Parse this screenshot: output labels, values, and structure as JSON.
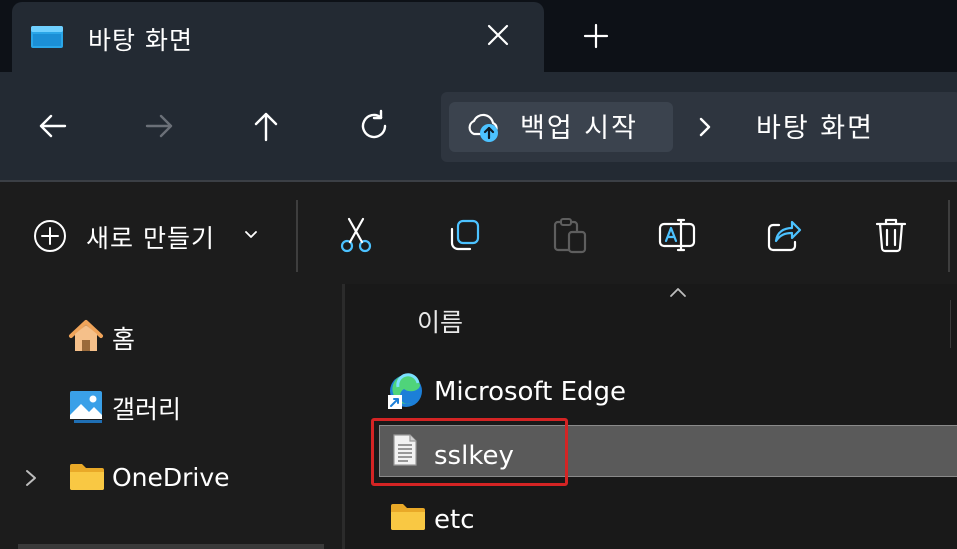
{
  "tab": {
    "title": "바탕 화면",
    "icon": "desktop-folder-icon",
    "close_icon": "close-icon",
    "new_tab_icon": "plus-icon"
  },
  "nav": {
    "back_icon": "arrow-left-icon",
    "forward_icon": "arrow-right-icon",
    "up_icon": "arrow-up-icon",
    "refresh_icon": "refresh-icon"
  },
  "address": {
    "backup_label": "백업 시작",
    "backup_icon": "cloud-upload-icon",
    "separator": "chevron-right-icon",
    "current": "바탕 화면"
  },
  "toolbar": {
    "new_label": "새로 만들기",
    "new_icon": "circle-plus-icon",
    "actions": [
      "cut-icon",
      "copy-icon",
      "paste-icon",
      "rename-icon",
      "share-icon",
      "delete-icon"
    ]
  },
  "sidebar": {
    "items": [
      {
        "label": "홈",
        "icon": "home-icon"
      },
      {
        "label": "갤러리",
        "icon": "gallery-icon"
      },
      {
        "label": "OneDrive",
        "icon": "folder-icon"
      }
    ]
  },
  "list": {
    "column_name": "이름",
    "files": [
      {
        "name": "Microsoft Edge",
        "icon": "edge-icon"
      },
      {
        "name": "sslkey",
        "icon": "text-document-icon",
        "selected": true
      },
      {
        "name": "etc",
        "icon": "folder-icon"
      }
    ]
  },
  "colors": {
    "accent_blue": "#4cc2ff",
    "folder_yellow": "#f9c843",
    "selection_gray": "#5a5a5a",
    "highlight_red": "#d42424"
  }
}
